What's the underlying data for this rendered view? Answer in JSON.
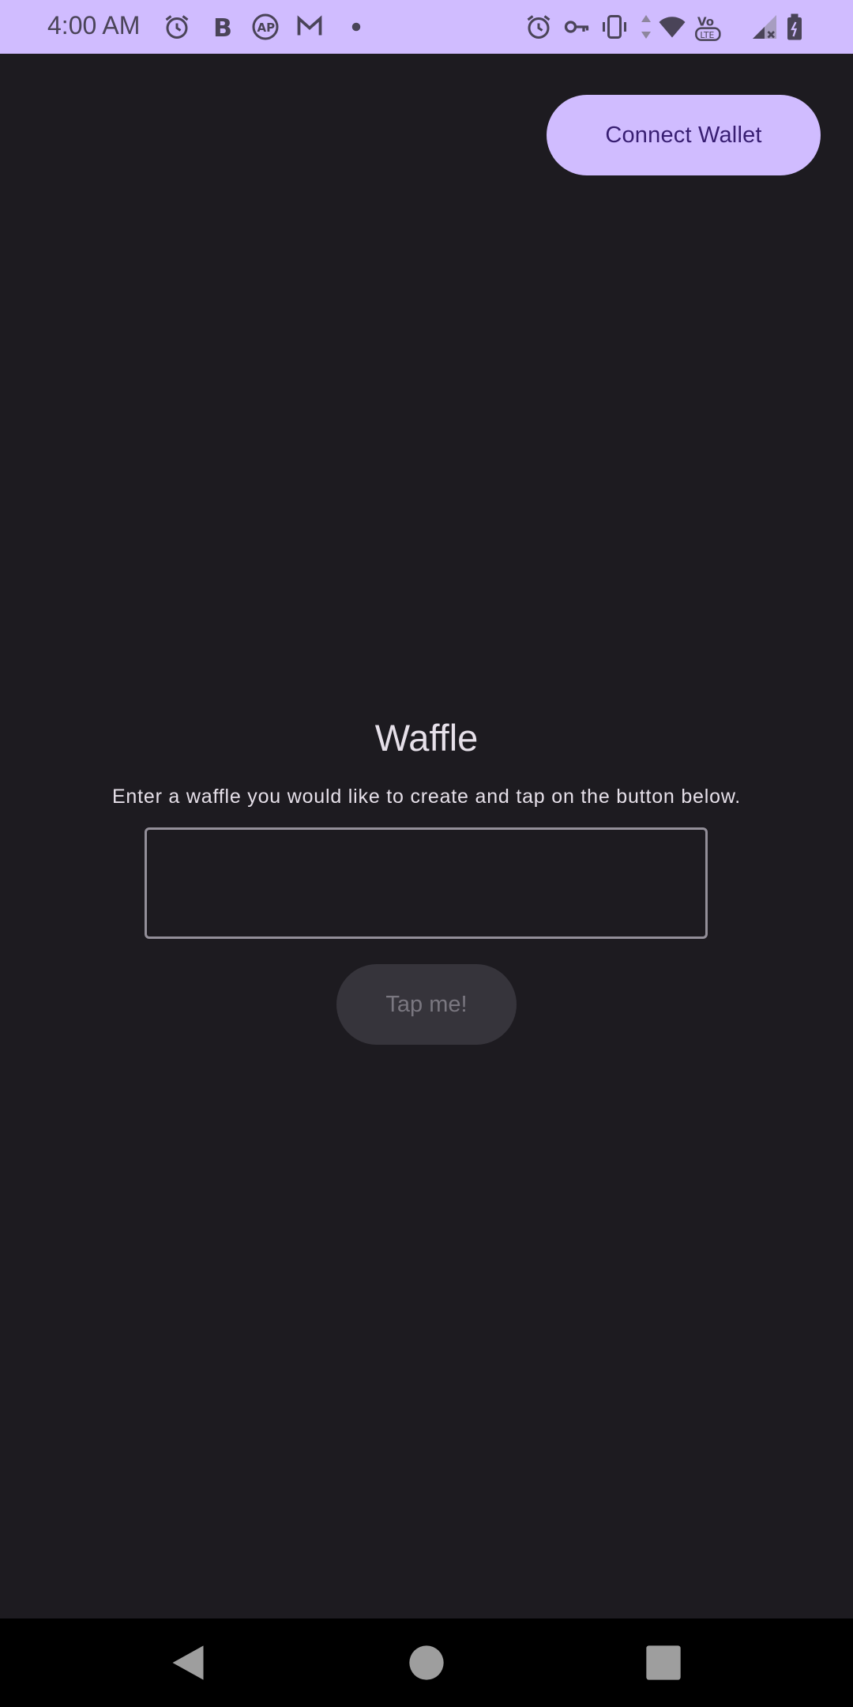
{
  "status_bar": {
    "time": "4:00 AM",
    "left_icons": [
      "alarm-icon",
      "bold-b-icon",
      "ap-icon",
      "gmail-icon",
      "dot-icon"
    ],
    "right_icons": [
      "alarm-icon",
      "key-icon",
      "vibrate-icon",
      "wifi-icon",
      "volte-icon",
      "signal-icon",
      "battery-icon"
    ]
  },
  "header": {
    "connect_label": "Connect Wallet"
  },
  "main": {
    "title": "Waffle",
    "subtitle": "Enter a waffle you would like to create and tap on the button below.",
    "input_value": "",
    "input_placeholder": "",
    "submit_label": "Tap me!"
  },
  "nav_bar": {
    "buttons": [
      "back-icon",
      "home-icon",
      "recents-icon"
    ]
  },
  "colors": {
    "background": "#1d1b20",
    "accent": "#d0bcff",
    "on_accent": "#381e72",
    "disabled_button": "#36343b"
  }
}
